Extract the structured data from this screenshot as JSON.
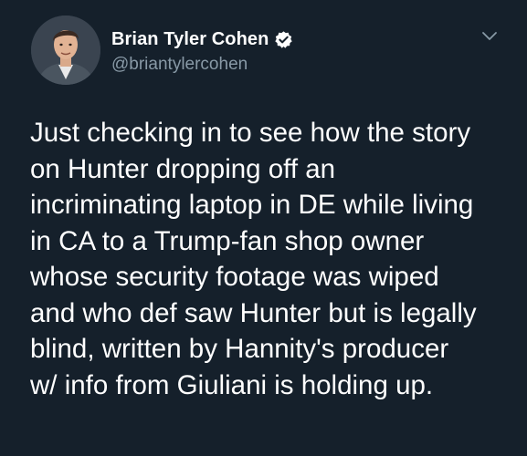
{
  "author": {
    "display_name": "Brian Tyler Cohen",
    "handle": "@briantylercohen",
    "verified": true,
    "avatar_icon": "profile-photo"
  },
  "menu": {
    "icon": "chevron-down-icon"
  },
  "tweet": {
    "lines": [
      "Just checking in to see how the story",
      "on Hunter dropping off an",
      "incriminating laptop in DE while living",
      "in CA to a Trump-fan shop owner",
      "whose security footage was wiped",
      "and who def saw Hunter but is legally",
      "blind, written by Hannity's producer",
      "w/ info from Giuliani is holding up."
    ]
  },
  "colors": {
    "background": "#15202b",
    "text_primary": "#ffffff",
    "text_secondary": "#8899a6",
    "verified_badge": "#ffffff"
  }
}
